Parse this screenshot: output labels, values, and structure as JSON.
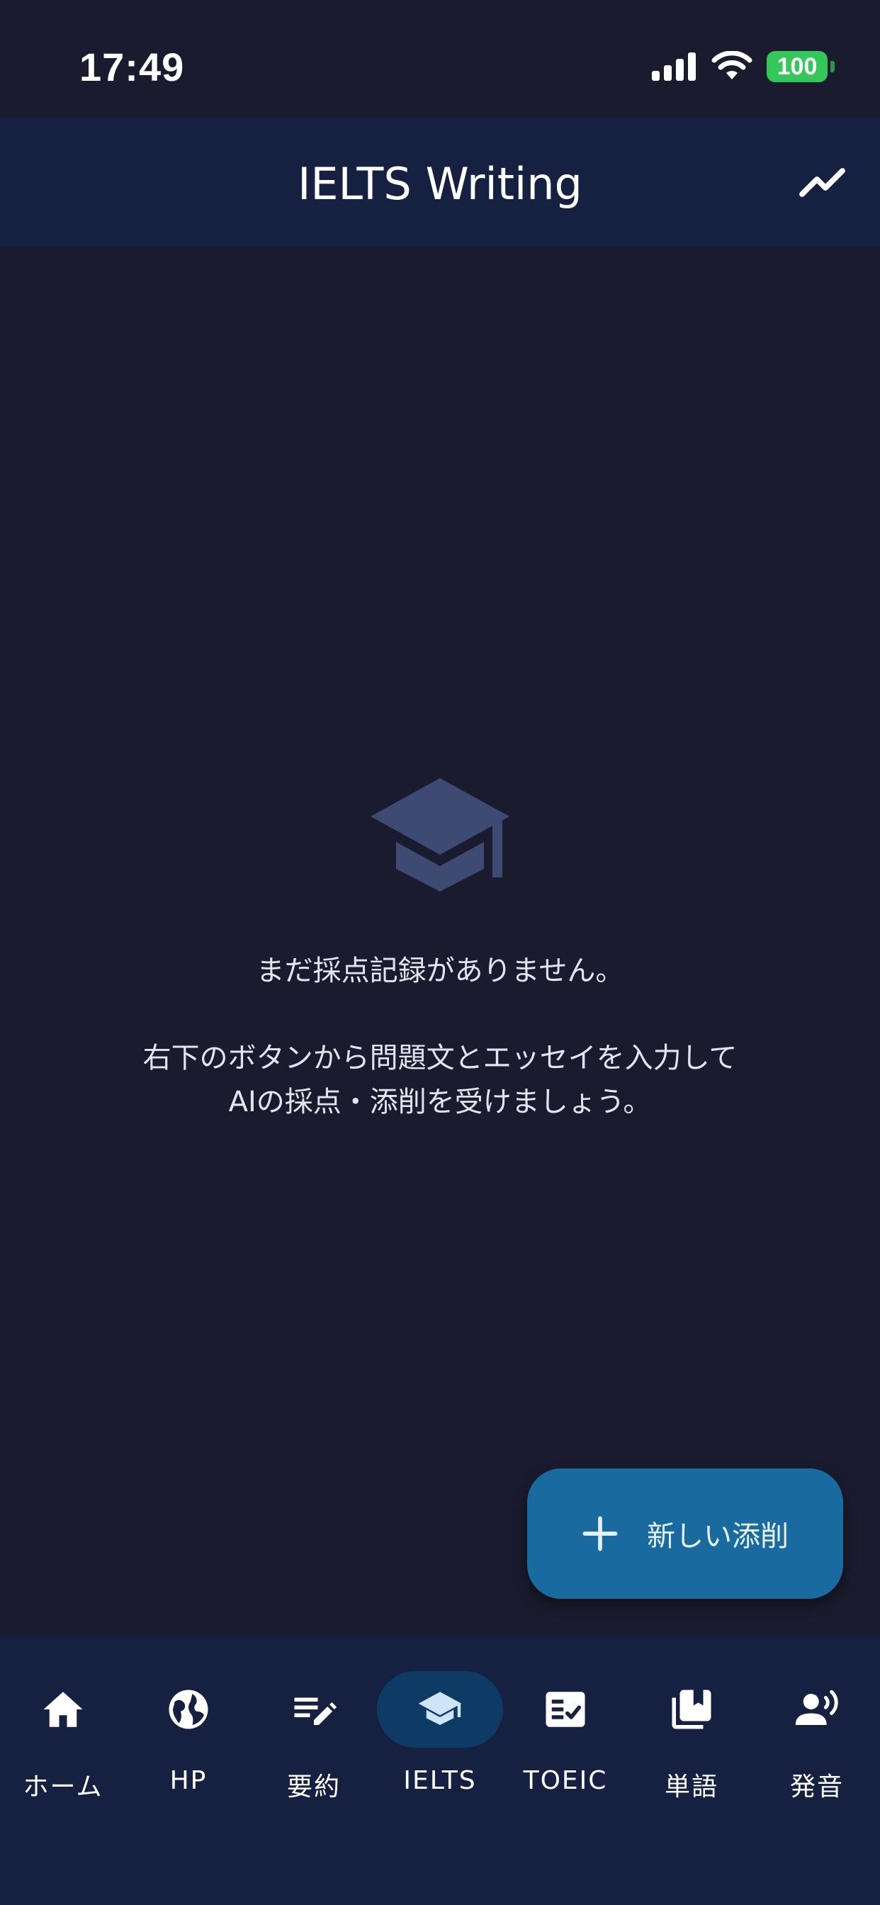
{
  "status_bar": {
    "time": "17:49",
    "battery": "100"
  },
  "header": {
    "title": "IELTS Writing",
    "trend_icon": "trending-up-icon"
  },
  "empty_state": {
    "icon": "graduation-cap-icon",
    "line1": "まだ採点記録がありません。",
    "line2": "右下のボタンから問題文とエッセイを入力して",
    "line3": "AIの採点・添削を受けましょう。"
  },
  "fab": {
    "icon": "plus-icon",
    "label": "新しい添削"
  },
  "nav": {
    "items": [
      {
        "label": "ホーム",
        "icon": "home-icon"
      },
      {
        "label": "HP",
        "icon": "globe-icon"
      },
      {
        "label": "要約",
        "icon": "edit-note-icon"
      },
      {
        "label": "IELTS",
        "icon": "graduation-cap-icon"
      },
      {
        "label": "TOEIC",
        "icon": "checklist-icon"
      },
      {
        "label": "単語",
        "icon": "library-books-icon"
      },
      {
        "label": "発音",
        "icon": "record-voice-icon"
      }
    ],
    "active_index": 3
  },
  "colors": {
    "background": "#1a1b2e",
    "header": "#162040",
    "fab": "#196a9e",
    "nav_active_pill": "#0e3b66",
    "battery": "#34c759",
    "empty_icon": "#3d4a72"
  }
}
